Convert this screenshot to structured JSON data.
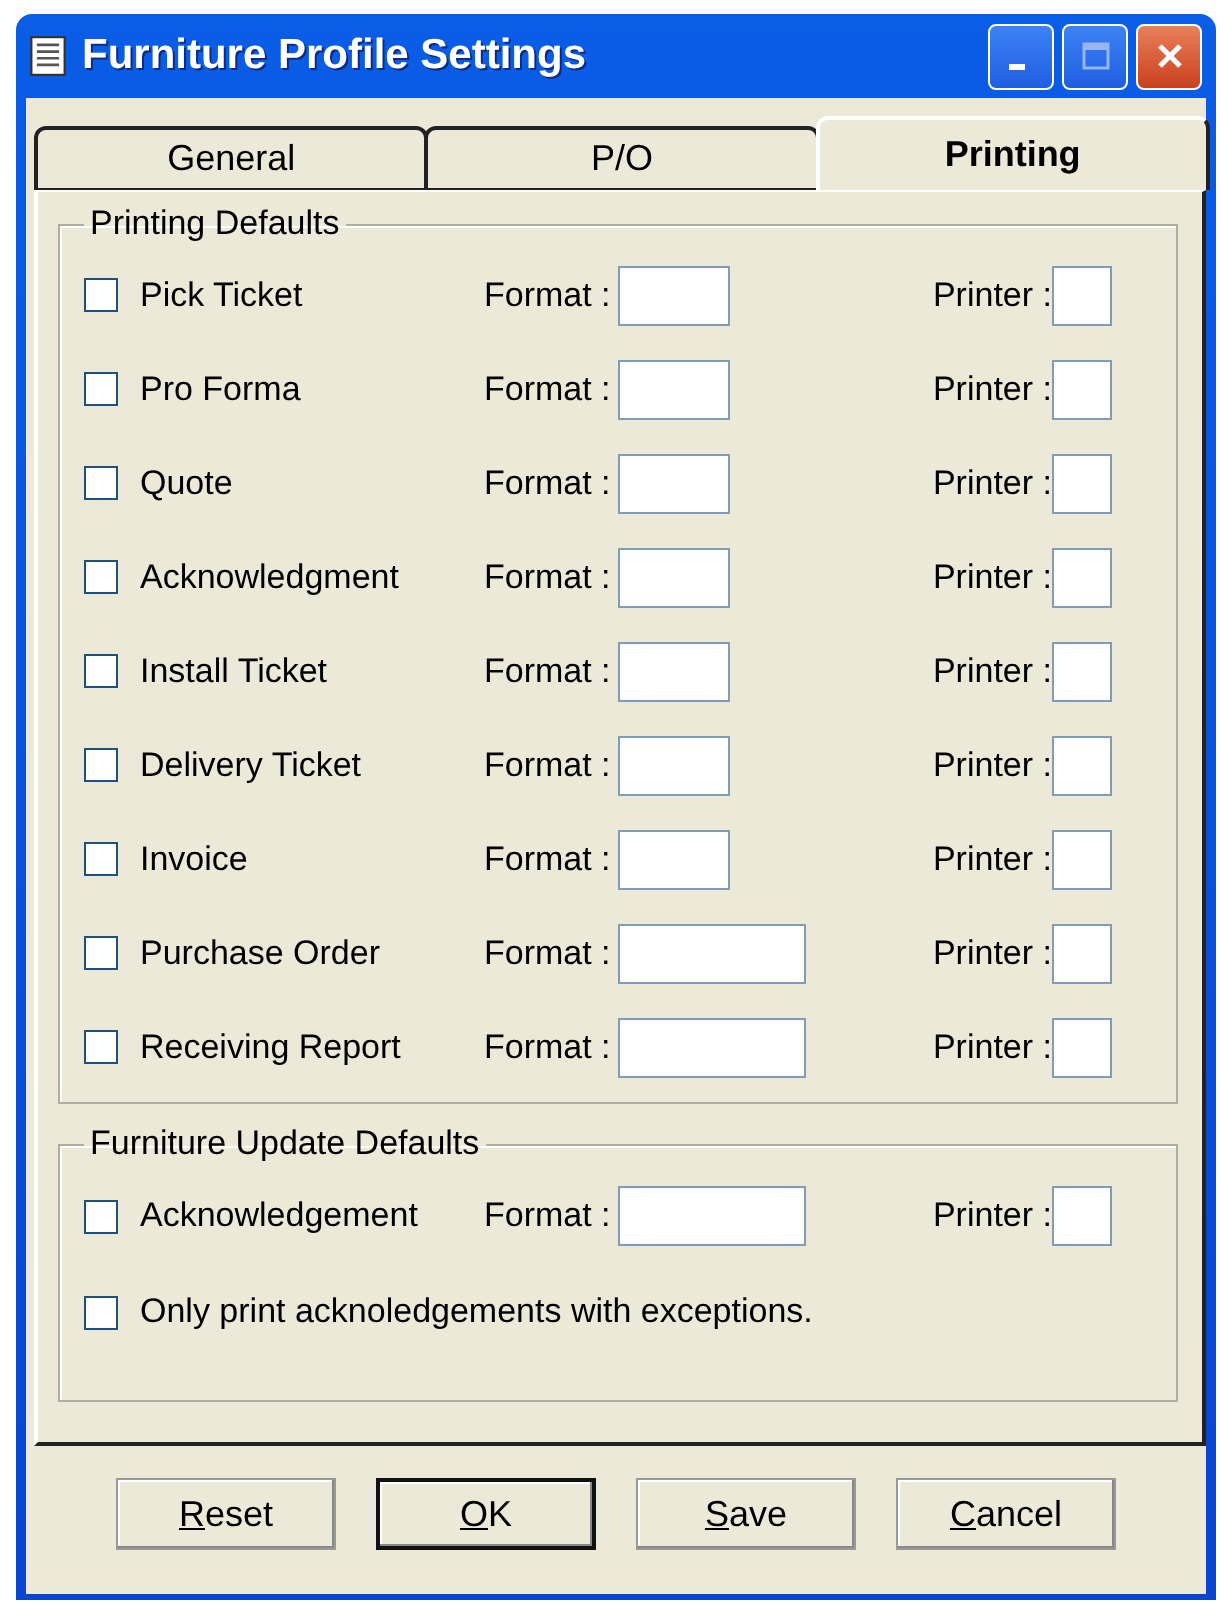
{
  "window": {
    "title": "Furniture Profile Settings"
  },
  "tabs": [
    {
      "label": "General",
      "selected": false
    },
    {
      "label": "P/O",
      "selected": false
    },
    {
      "label": "Printing",
      "selected": true
    }
  ],
  "printing_defaults": {
    "title": "Printing Defaults",
    "rows": [
      {
        "label": "Pick Ticket",
        "checked": false,
        "format_label": "Format :",
        "format_wide": false,
        "printer_label": "Printer :"
      },
      {
        "label": "Pro Forma",
        "checked": false,
        "format_label": "Format :",
        "format_wide": false,
        "printer_label": "Printer :"
      },
      {
        "label": "Quote",
        "checked": false,
        "format_label": "Format :",
        "format_wide": false,
        "printer_label": "Printer :"
      },
      {
        "label": "Acknowledgment",
        "checked": false,
        "format_label": "Format :",
        "format_wide": false,
        "printer_label": "Printer :"
      },
      {
        "label": "Install Ticket",
        "checked": false,
        "format_label": "Format :",
        "format_wide": false,
        "printer_label": "Printer :"
      },
      {
        "label": "Delivery Ticket",
        "checked": false,
        "format_label": "Format :",
        "format_wide": false,
        "printer_label": "Printer :"
      },
      {
        "label": "Invoice",
        "checked": false,
        "format_label": "Format :",
        "format_wide": false,
        "printer_label": "Printer :"
      },
      {
        "label": "Purchase Order",
        "checked": false,
        "format_label": "Format :",
        "format_wide": true,
        "printer_label": "Printer :"
      },
      {
        "label": "Receiving Report",
        "checked": false,
        "format_label": "Format :",
        "format_wide": true,
        "printer_label": "Printer :"
      }
    ]
  },
  "furniture_update_defaults": {
    "title": "Furniture Update Defaults",
    "row": {
      "label": "Acknowledgement",
      "checked": false,
      "format_label": "Format :",
      "format_wide": true,
      "printer_label": "Printer :"
    },
    "exceptions_only": {
      "label": "Only print acknoledgements with exceptions.",
      "checked": false
    }
  },
  "buttons": [
    {
      "label": "Reset",
      "default": false,
      "mnemonic_first": true
    },
    {
      "label": "OK",
      "default": true,
      "mnemonic_first": true
    },
    {
      "label": "Save",
      "default": false,
      "mnemonic_first": true
    },
    {
      "label": "Cancel",
      "default": false,
      "mnemonic_first": true
    }
  ]
}
